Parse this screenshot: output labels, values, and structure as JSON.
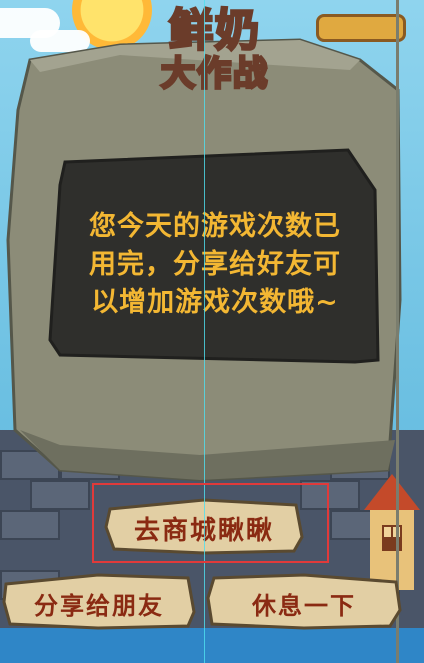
{
  "title": {
    "line1": "鲜奶",
    "line2": "大作战"
  },
  "dialog": {
    "message_lines": [
      "您今天的游戏次数已",
      "用完，分享给好友可",
      "以增加游戏次数哦~"
    ]
  },
  "buttons": {
    "shop_label": "去商城瞅瞅",
    "share_label": "分享给朋友",
    "rest_label": "休息一下"
  },
  "colors": {
    "message_text": "#f3b733",
    "button_text": "#8a2a12",
    "stone": "#8c8c78",
    "stone_panel": "#2f2f2c",
    "button_fill": "#e2cfa4",
    "selection_outline": "#e03a3a",
    "guide_line": "#4fe0f0"
  },
  "icons": {
    "sun": "sun-icon",
    "house": "house-icon"
  }
}
